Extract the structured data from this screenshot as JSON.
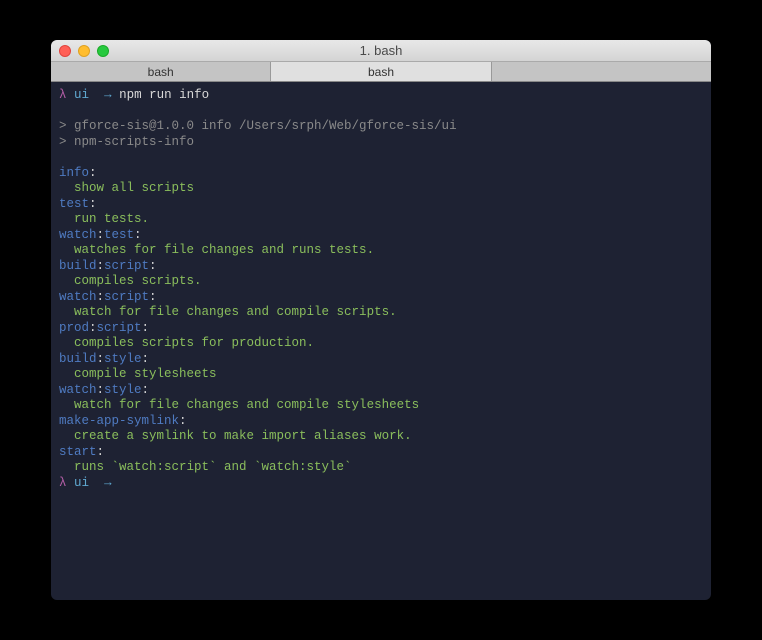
{
  "window": {
    "title": "1. bash"
  },
  "tabs": [
    {
      "label": "bash",
      "active": false
    },
    {
      "label": "bash",
      "active": true
    },
    {
      "label": "",
      "active": false
    }
  ],
  "prompt": {
    "lambda": "λ",
    "cwd": "ui",
    "arrow": "→"
  },
  "command": "npm run info",
  "output_header": {
    "line1": "> gforce-sis@1.0.0 info /Users/srph/Web/gforce-sis/ui",
    "line2": "> npm-scripts-info"
  },
  "scripts": [
    {
      "name": "info",
      "desc": "show all scripts"
    },
    {
      "name": "test",
      "desc": "run tests."
    },
    {
      "name": "watch:test",
      "desc": "watches for file changes and runs tests."
    },
    {
      "name": "build:script",
      "desc": "compiles scripts."
    },
    {
      "name": "watch:script",
      "desc": "watch for file changes and compile scripts."
    },
    {
      "name": "prod:script",
      "desc": "compiles scripts for production."
    },
    {
      "name": "build:style",
      "desc": "compile stylesheets"
    },
    {
      "name": "watch:style",
      "desc": "watch for file changes and compile stylesheets"
    },
    {
      "name": "make-app-symlink",
      "desc": "create a symlink to make import aliases work."
    },
    {
      "name": "start",
      "desc": "runs `watch:script` and `watch:style`"
    }
  ],
  "colon": ":"
}
